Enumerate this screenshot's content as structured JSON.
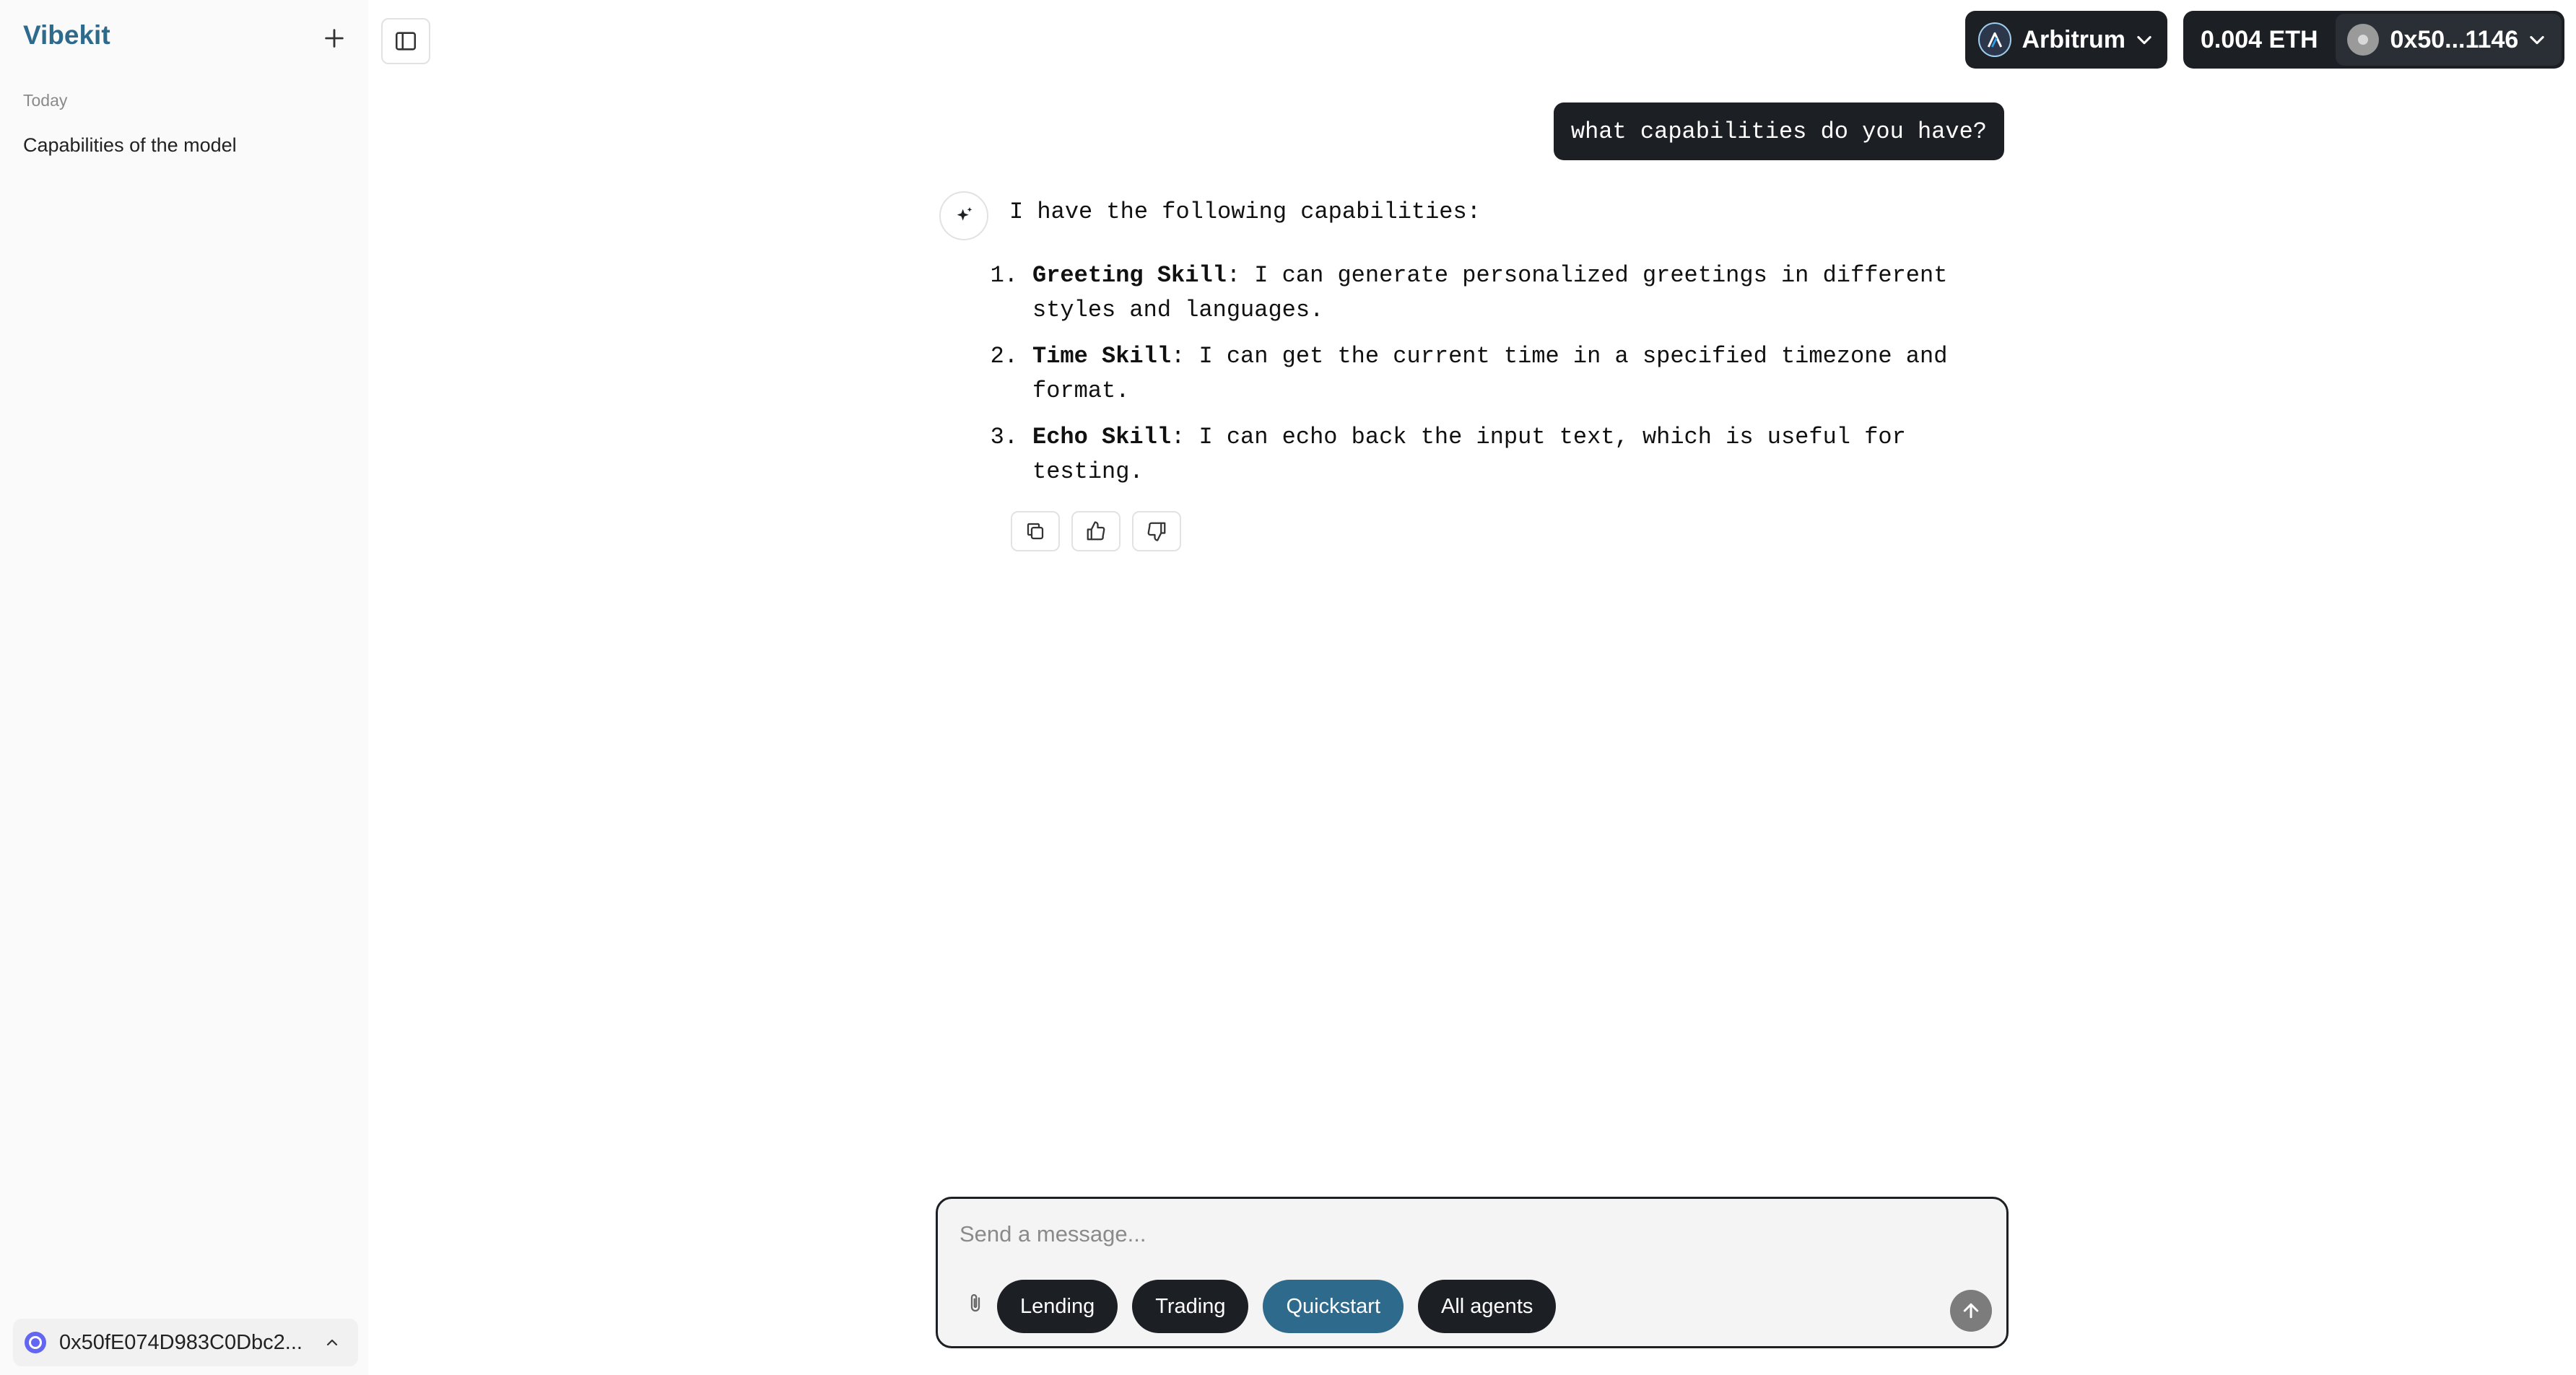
{
  "sidebar": {
    "brand": "Vibekit",
    "section_label": "Today",
    "history": [
      {
        "title": "Capabilities of the model"
      }
    ],
    "wallet_address": "0x50fE074D983C0Dbc2..."
  },
  "header": {
    "network": "Arbitrum",
    "balance": "0.004 ETH",
    "account": "0x50...1146"
  },
  "chat": {
    "user_message": "what capabilities do you have?",
    "assistant_intro": "I have the following capabilities:",
    "capabilities": [
      {
        "num": "1.",
        "name": "Greeting Skill",
        "desc": ": I can generate personalized greetings in different styles and languages."
      },
      {
        "num": "2.",
        "name": "Time Skill",
        "desc": ": I can get the current time in a specified timezone and format."
      },
      {
        "num": "3.",
        "name": "Echo Skill",
        "desc": ": I can echo back the input text, which is useful for testing."
      }
    ]
  },
  "composer": {
    "placeholder": "Send a message...",
    "chips": [
      {
        "label": "Lending",
        "active": false
      },
      {
        "label": "Trading",
        "active": false
      },
      {
        "label": "Quickstart",
        "active": true
      },
      {
        "label": "All agents",
        "active": false
      }
    ]
  },
  "colors": {
    "brand": "#2e6a8c",
    "dark_button": "#1c1f24",
    "sidebar_bg": "#fafafa"
  },
  "icons": [
    "plus-icon",
    "sidebar-toggle-icon",
    "arbitrum-logo-icon",
    "chevron-down-icon",
    "sparkle-icon",
    "copy-icon",
    "thumbs-up-icon",
    "thumbs-down-icon",
    "paperclip-icon",
    "arrow-up-icon",
    "chevron-up-icon"
  ]
}
